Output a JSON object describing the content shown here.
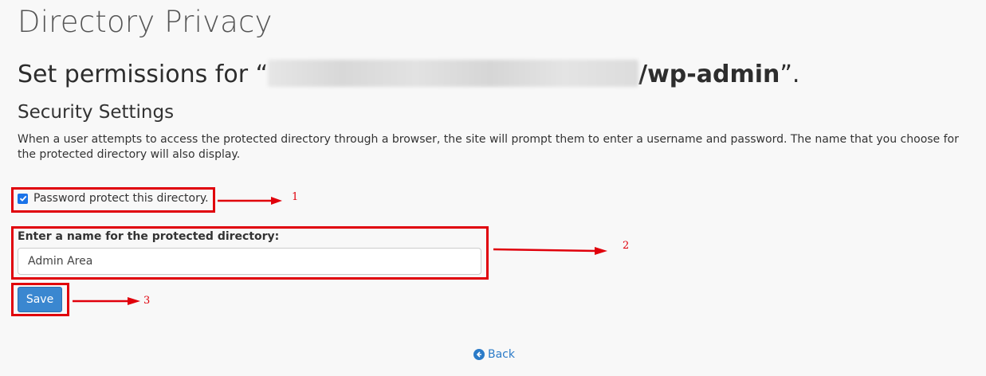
{
  "page": {
    "title": "Directory Privacy"
  },
  "permissions": {
    "prefix": "Set permissions for “",
    "path_suffix": "/wp-admin",
    "suffix": "”."
  },
  "security": {
    "title": "Security Settings",
    "description": "When a user attempts to access the protected directory through a browser, the site will prompt them to enter a username and password. The name that you choose for the protected directory will also display."
  },
  "protect_checkbox": {
    "label": "Password protect this directory.",
    "checked": true
  },
  "name_field": {
    "label": "Enter a name for the protected directory:",
    "value": "Admin Area"
  },
  "actions": {
    "save_label": "Save",
    "back_label": "Back",
    "back_icon": "arrow-circle-left-icon"
  },
  "annotations": {
    "step1": "1",
    "step2": "2",
    "step3": "3",
    "color": "#e0000b"
  }
}
